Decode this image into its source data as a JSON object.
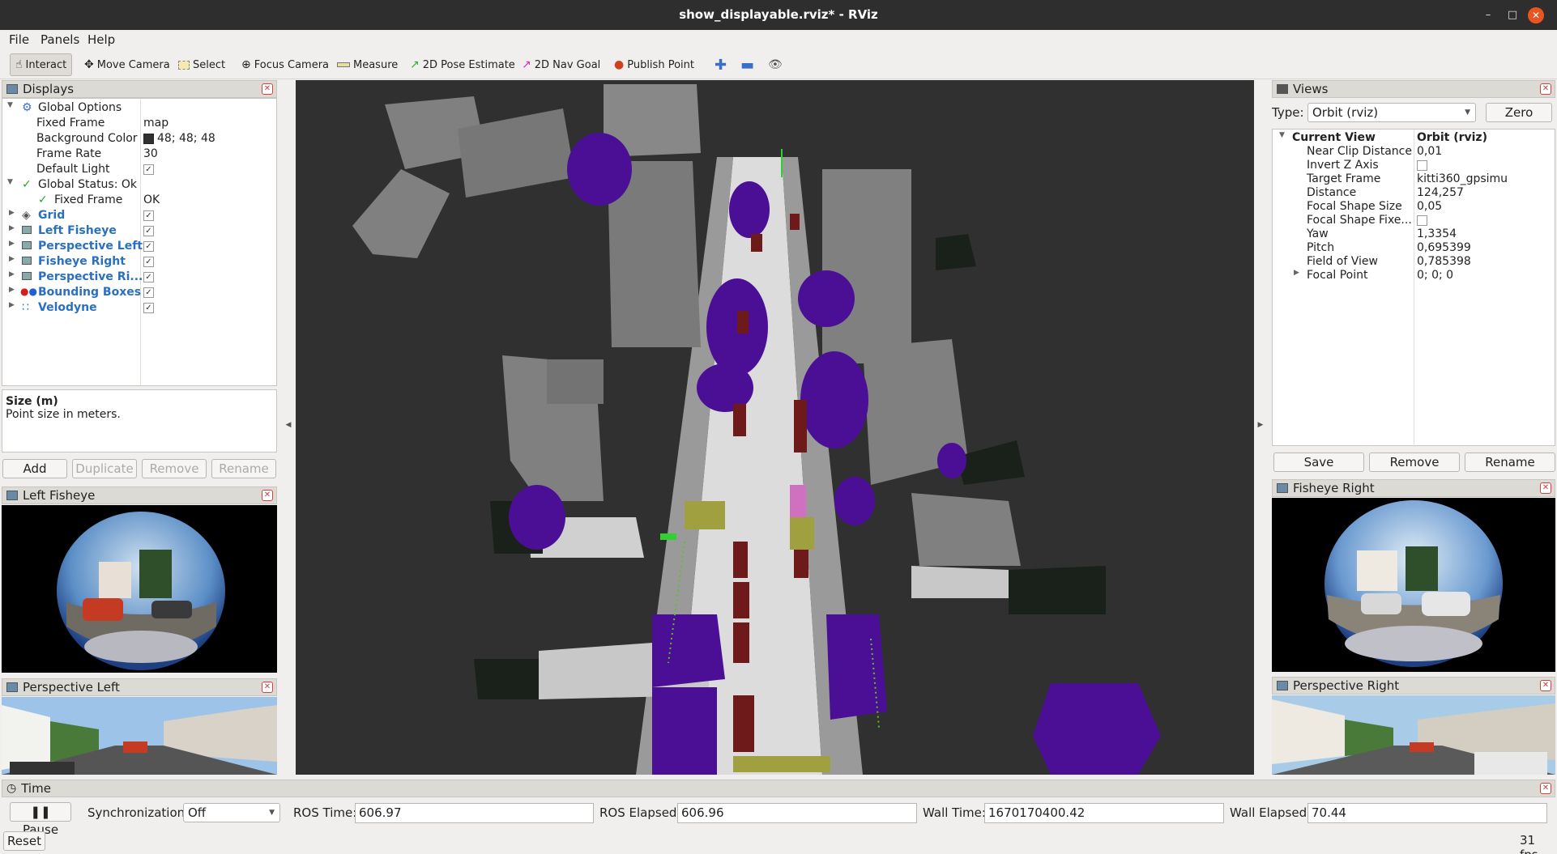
{
  "window": {
    "title": "show_displayable.rviz* - RViz"
  },
  "menu": {
    "file": "File",
    "panels": "Panels",
    "help": "Help"
  },
  "toolbar": {
    "interact": "Interact",
    "move_camera": "Move Camera",
    "select": "Select",
    "focus_camera": "Focus Camera",
    "measure": "Measure",
    "pose_estimate": "2D Pose Estimate",
    "nav_goal": "2D Nav Goal",
    "publish_point": "Publish Point"
  },
  "displays": {
    "title": "Displays",
    "global_options": "Global Options",
    "fixed_frame_label": "Fixed Frame",
    "fixed_frame_value": "map",
    "bg_color_label": "Background Color",
    "bg_color_value": "48; 48; 48",
    "frame_rate_label": "Frame Rate",
    "frame_rate_value": "30",
    "default_light_label": "Default Light",
    "global_status": "Global Status: Ok",
    "status_fixed_frame": "Fixed Frame",
    "status_fixed_frame_value": "OK",
    "items": [
      {
        "label": "Grid",
        "checked": true
      },
      {
        "label": "Left Fisheye",
        "checked": true
      },
      {
        "label": "Perspective Left",
        "checked": true
      },
      {
        "label": "Fisheye Right",
        "checked": true
      },
      {
        "label": "Perspective Ri...",
        "checked": true
      },
      {
        "label": "Bounding Boxes",
        "checked": true
      },
      {
        "label": "Velodyne",
        "checked": true
      }
    ],
    "help_title": "Size (m)",
    "help_text": "Point size in meters.",
    "add": "Add",
    "duplicate": "Duplicate",
    "remove": "Remove",
    "rename": "Rename"
  },
  "left_fisheye": {
    "title": "Left Fisheye"
  },
  "perspective_left": {
    "title": "Perspective Left"
  },
  "views": {
    "title": "Views",
    "type_label": "Type:",
    "type_value": "Orbit (rviz)",
    "zero": "Zero",
    "current_view": "Current View",
    "current_view_value": "Orbit (rviz)",
    "props": [
      {
        "label": "Near Clip Distance",
        "value": "0,01"
      },
      {
        "label": "Invert Z Axis",
        "value": ""
      },
      {
        "label": "Target Frame",
        "value": "kitti360_gpsimu"
      },
      {
        "label": "Distance",
        "value": "124,257"
      },
      {
        "label": "Focal Shape Size",
        "value": "0,05"
      },
      {
        "label": "Focal Shape Fixe...",
        "value": ""
      },
      {
        "label": "Yaw",
        "value": "1,3354"
      },
      {
        "label": "Pitch",
        "value": "0,695399"
      },
      {
        "label": "Field of View",
        "value": "0,785398"
      },
      {
        "label": "Focal Point",
        "value": "0; 0; 0"
      }
    ],
    "save": "Save",
    "remove": "Remove",
    "rename": "Rename"
  },
  "fisheye_right": {
    "title": "Fisheye Right"
  },
  "perspective_right": {
    "title": "Perspective Right"
  },
  "time": {
    "title": "Time",
    "pause": "Pause",
    "sync_label": "Synchronization:",
    "sync_value": "Off",
    "ros_time_label": "ROS Time:",
    "ros_time": "606.97",
    "ros_elapsed_label": "ROS Elapsed:",
    "ros_elapsed": "606.96",
    "wall_time_label": "Wall Time:",
    "wall_time": "1670170400.42",
    "wall_elapsed_label": "Wall Elapsed:",
    "wall_elapsed": "70.44",
    "reset": "Reset",
    "fps": "31 fps"
  },
  "colors": {
    "background": "#303030",
    "building": "#808080",
    "road": "#dcdcdc",
    "vegetation": "#4b0f96",
    "car": "#6e1a1a",
    "terrain": "#a0a040",
    "dark": "#1a201a"
  }
}
